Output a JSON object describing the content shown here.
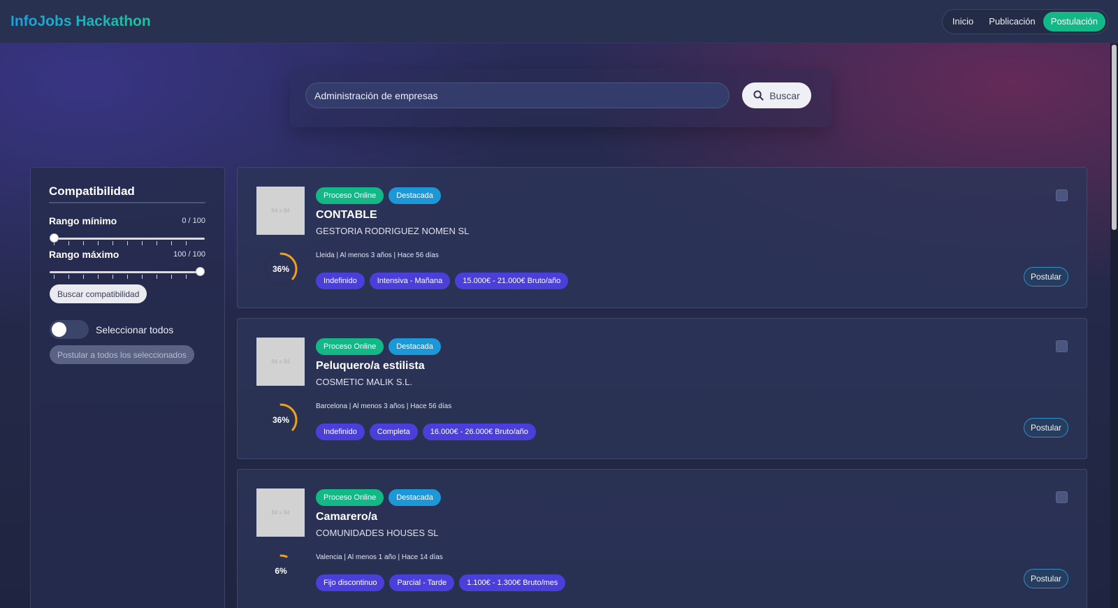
{
  "header": {
    "brand": "InfoJobs Hackathon",
    "nav": [
      {
        "label": "Inicio",
        "active": false
      },
      {
        "label": "Publicación",
        "active": false
      },
      {
        "label": "Postulación",
        "active": true
      }
    ]
  },
  "search": {
    "value": "Administración de empresas",
    "button_label": "Buscar"
  },
  "sidebar": {
    "title": "Compatibilidad",
    "min_label": "Rango mínimo",
    "min_value_text": "0 / 100",
    "min_value": 0,
    "max_label": "Rango máximo",
    "max_value_text": "100 / 100",
    "max_value": 100,
    "search_button": "Buscar compatibilidad",
    "toggle_label": "Seleccionar todos",
    "toggle_on": false,
    "apply_all_button": "Postular a todos los seleccionados"
  },
  "jobs": [
    {
      "thumb_text": "84 x 84",
      "badges": [
        "Proceso Online",
        "Destacada"
      ],
      "title": "CONTABLE",
      "company": "GESTORIA RODRIGUEZ NOMEN SL",
      "meta": "Lleida | Al menos 3 años | Hace 56 días",
      "compatibility": 36,
      "compatibility_text": "36%",
      "chips": [
        "Indefinido",
        "Intensiva - Mañana",
        "15.000€ - 21.000€ Bruto/año"
      ],
      "apply_label": "Postular"
    },
    {
      "thumb_text": "84 x 84",
      "badges": [
        "Proceso Online",
        "Destacada"
      ],
      "title": "Peluquero/a estilista",
      "company": "COSMETIC MALIK S.L.",
      "meta": "Barcelona | Al menos 3 años | Hace 56 días",
      "compatibility": 36,
      "compatibility_text": "36%",
      "chips": [
        "Indefinido",
        "Completa",
        "16.000€ - 26.000€ Bruto/año"
      ],
      "apply_label": "Postular"
    },
    {
      "thumb_text": "84 x 84",
      "badges": [
        "Proceso Online",
        "Destacada"
      ],
      "title": "Camarero/a",
      "company": "COMUNIDADES HOUSES SL",
      "meta": "Valencia | Al menos 1 año | Hace 14 días",
      "compatibility": 6,
      "compatibility_text": "6%",
      "chips": [
        "Fijo discontinuo",
        "Parcial - Tarde",
        "1.100€ - 1.300€ Bruto/mes"
      ],
      "apply_label": "Postular"
    }
  ],
  "colors": {
    "accent_green": "#12b886",
    "accent_blue": "#1c98d8",
    "chip_purple": "#4a3fd8",
    "ring_orange": "#f0a020"
  }
}
